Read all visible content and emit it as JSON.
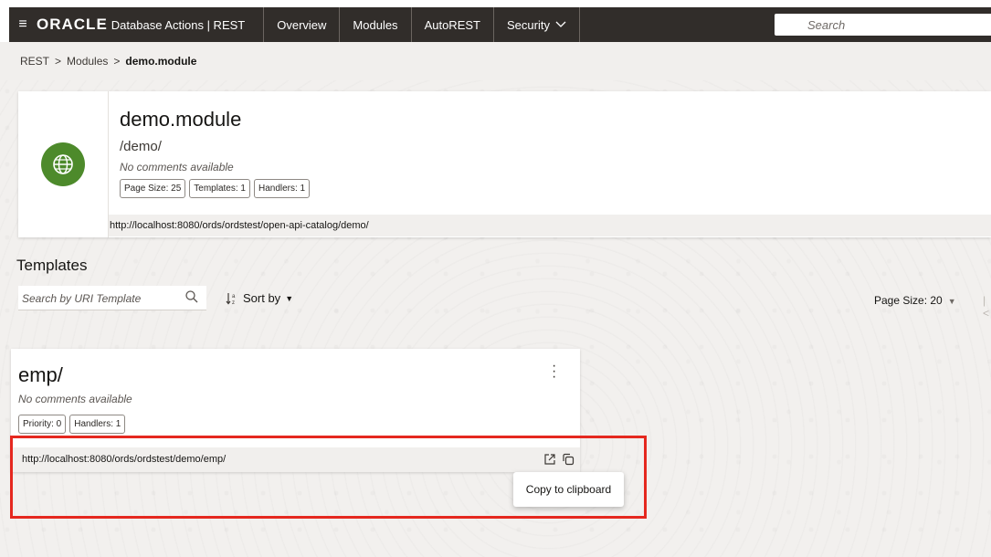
{
  "header": {
    "brand": "ORACLE",
    "app_title": "Database Actions | REST",
    "tabs": [
      {
        "label": "Overview"
      },
      {
        "label": "Modules"
      },
      {
        "label": "AutoREST"
      },
      {
        "label": "Security"
      }
    ],
    "search_placeholder": "Search"
  },
  "breadcrumb": {
    "items": [
      "REST",
      "Modules"
    ],
    "separator": ">",
    "current": "demo.module"
  },
  "module": {
    "name": "demo.module",
    "base_path": "/demo/",
    "comment": "No comments available",
    "badges": [
      "Page Size: 25",
      "Templates: 1",
      "Handlers: 1"
    ],
    "url": "http://localhost:8080/ords/ordstest/open-api-catalog/demo/",
    "icon": "globe-icon",
    "icon_color": "#4d8a2b"
  },
  "templates": {
    "heading": "Templates",
    "search_placeholder": "Search by URI Template",
    "sort_label": "Sort by",
    "page_size_label": "Page Size: 20",
    "items": [
      {
        "uri": "emp/",
        "comment": "No comments available",
        "badges": [
          "Priority: 0",
          "Handlers: 1"
        ],
        "url": "http://localhost:8080/ords/ordstest/demo/emp/"
      }
    ]
  },
  "tooltip": {
    "text": "Copy to clipboard"
  },
  "colors": {
    "topbar": "#312d2a",
    "highlight": "#e5281f"
  }
}
